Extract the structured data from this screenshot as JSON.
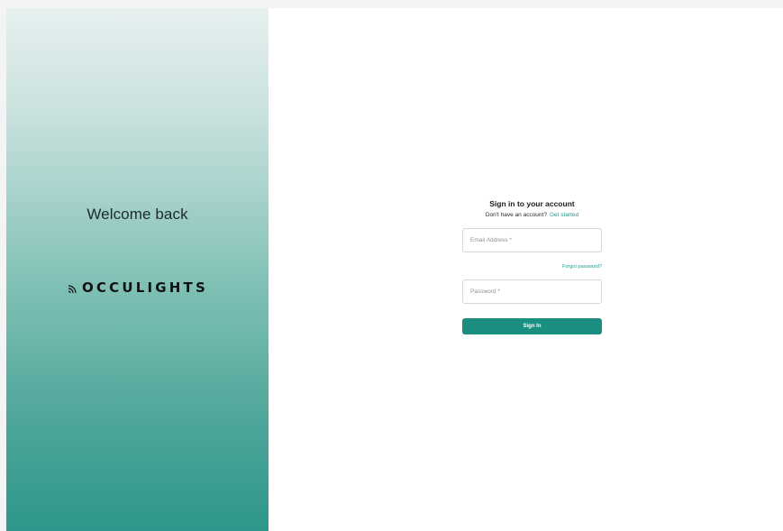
{
  "welcome": {
    "heading": "Welcome back",
    "logo_text": "OCCULIGHTS",
    "logo_icon": "signal-waves-icon"
  },
  "signin": {
    "title": "Sign in to your account",
    "no_account_text": "Don't have an account?",
    "get_started_link": "Get started",
    "email_placeholder": "Email Address *",
    "forgot_password_link": "Forgot password?",
    "password_placeholder": "Password *",
    "submit_label": "Sign In"
  },
  "colors": {
    "accent": "#1b8f7f",
    "link": "#1a9e8c",
    "gradient_top": "#e6f0ef",
    "gradient_bottom": "#2e968a"
  }
}
